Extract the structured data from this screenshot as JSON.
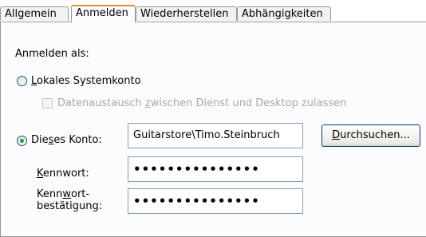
{
  "tabs": [
    {
      "label": "Allgemein",
      "active": false
    },
    {
      "label": "Anmelden",
      "active": true
    },
    {
      "label": "Wiederherstellen",
      "active": false
    },
    {
      "label": "Abhängigkeiten",
      "active": false
    }
  ],
  "logon": {
    "heading": "Anmelden als:",
    "local_system": {
      "label": "Lokales Systemkonto",
      "selected": false
    },
    "desktop_interaction": {
      "label": "Datenaustausch zwischen Dienst und Desktop zulassen",
      "checked": false,
      "enabled": false
    },
    "this_account": {
      "label": "Dieses Konto:",
      "selected": true,
      "value": "Guitarstore\\Timo.Steinbruch"
    },
    "browse_button": "Durchsuchen...",
    "password": {
      "label": "Kennwort:",
      "value": "•••••••••••••••"
    },
    "confirm_password": {
      "label_line1": "Kennwort-",
      "label_line2": "bestätigung:",
      "value": "•••••••••••••••"
    }
  },
  "colors": {
    "tab_active_accent": "#e68b2c",
    "radio_selected": "#21a121",
    "field_border": "#7f9db9"
  }
}
